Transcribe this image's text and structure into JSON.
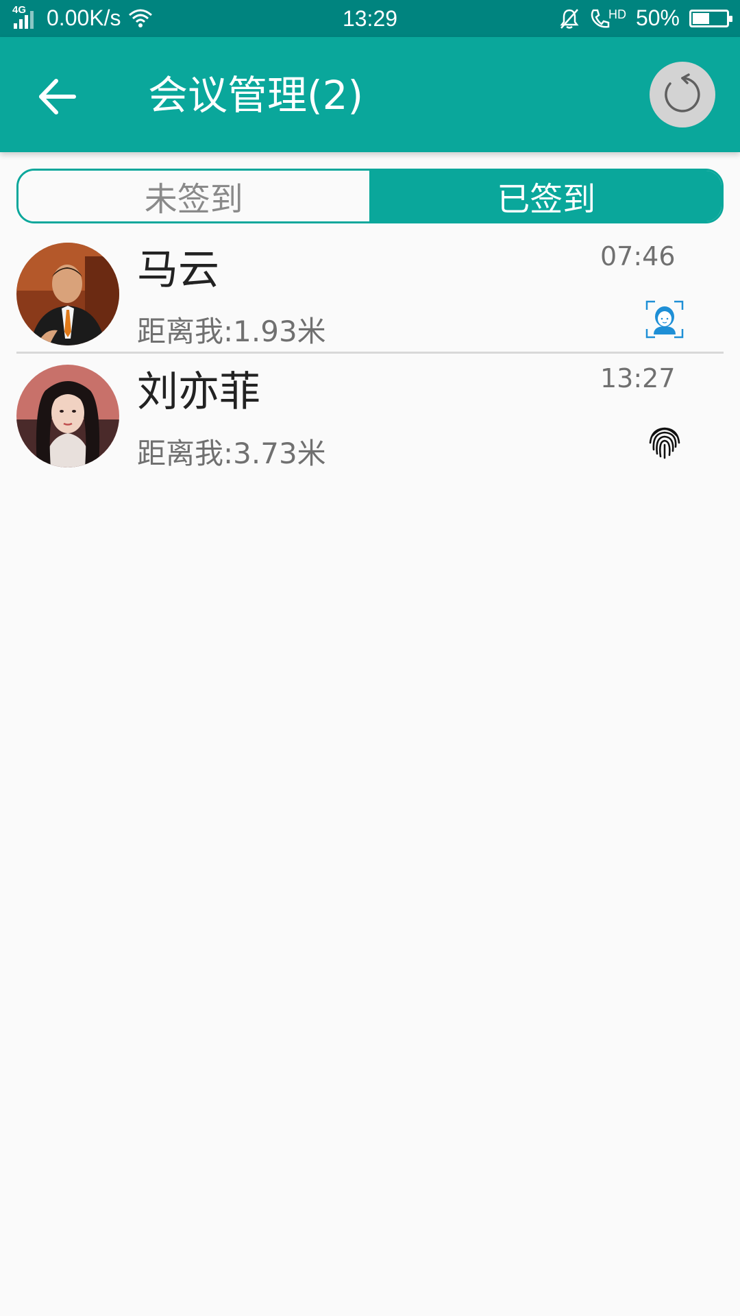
{
  "status_bar": {
    "network_type": "4G",
    "speed": "0.00K/s",
    "time": "13:29",
    "hd_label": "HD",
    "battery": "50%",
    "battery_level": 0.5
  },
  "app_bar": {
    "title": "会议管理(2)",
    "back_icon": "arrow-left-icon",
    "refresh_icon": "refresh-icon"
  },
  "tabs": [
    {
      "label": "未签到",
      "active": false
    },
    {
      "label": "已签到",
      "active": true
    }
  ],
  "attendees": [
    {
      "name": "马云",
      "distance": "距离我:1.93米",
      "time": "07:46",
      "method_icon": "face-scan-icon"
    },
    {
      "name": "刘亦菲",
      "distance": "距离我:3.73米",
      "time": "13:27",
      "method_icon": "fingerprint-icon"
    }
  ],
  "colors": {
    "status_bar": "#00847f",
    "primary": "#0aa79b",
    "refresh_bg": "#d3d3d3",
    "face_icon": "#1e8fd6"
  }
}
